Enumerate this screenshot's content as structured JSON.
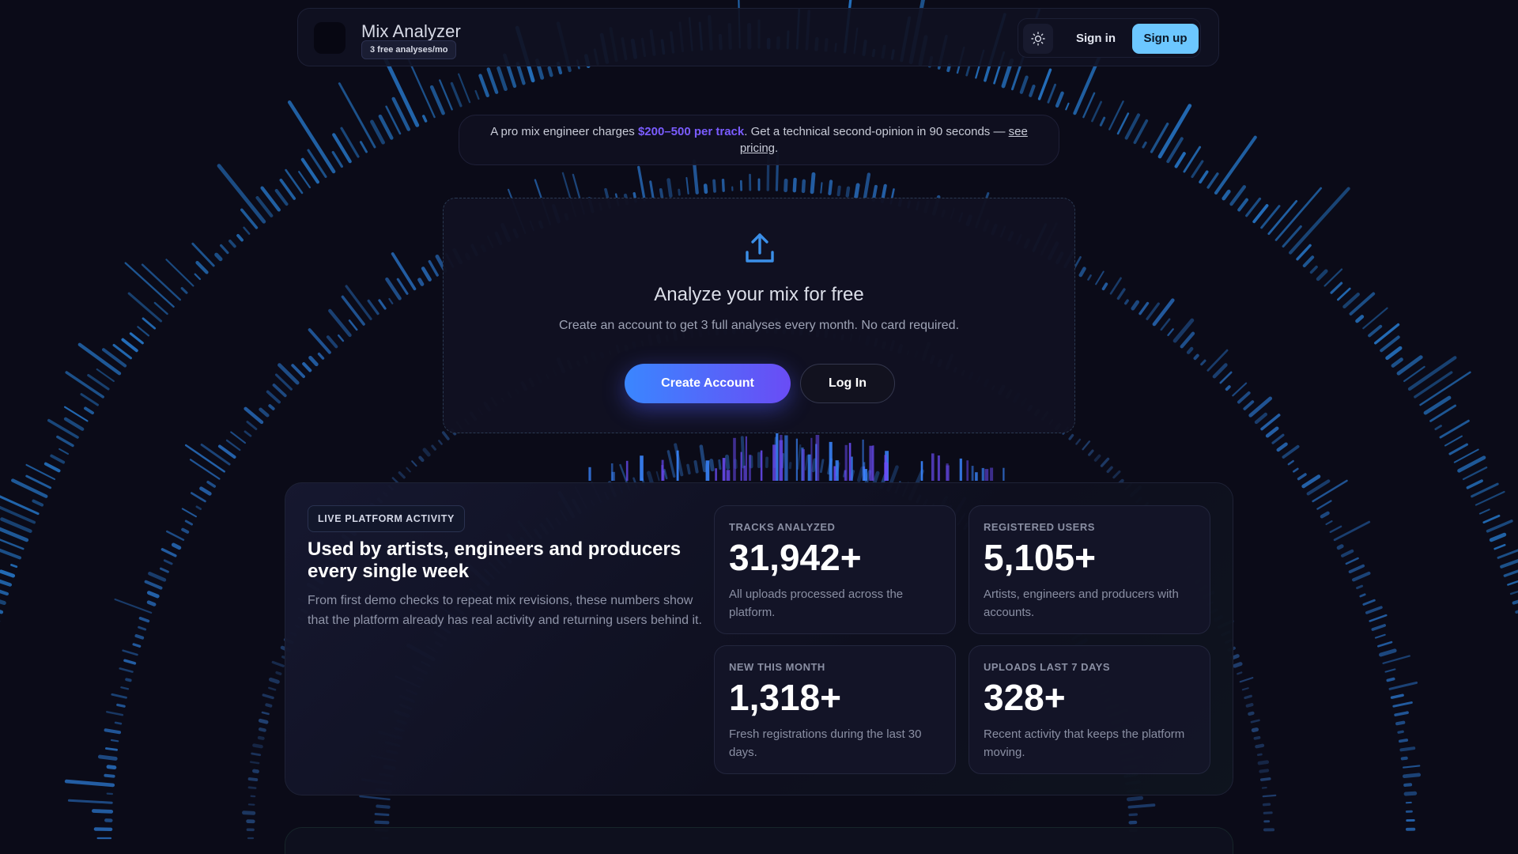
{
  "header": {
    "title": "Mix Analyzer",
    "badge": "3 free analyses/mo",
    "theme_icon": "sun-icon",
    "signin_label": "Sign in",
    "signup_label": "Sign up"
  },
  "banner": {
    "prefix": "A pro mix engineer charges ",
    "price": "$200–500 per track",
    "middle": ". Get a technical second-opinion in 90 seconds — ",
    "link": "see pricing",
    "suffix": "."
  },
  "cta": {
    "icon": "upload-icon",
    "title": "Analyze your mix for free",
    "subtitle": "Create an account to get 3 full analyses every month. No card required.",
    "create_label": "Create Account",
    "login_label": "Log In"
  },
  "stats": {
    "badge": "LIVE PLATFORM ACTIVITY",
    "heading": "Used by artists, engineers and producers every single week",
    "description": "From first demo checks to repeat mix revisions, these numbers show that the platform already has real activity and returning users behind it.",
    "cards": [
      {
        "label": "TRACKS ANALYZED",
        "value": "31,942+",
        "note": "All uploads processed across the platform."
      },
      {
        "label": "REGISTERED USERS",
        "value": "5,105+",
        "note": "Artists, engineers and producers with accounts."
      },
      {
        "label": "NEW THIS MONTH",
        "value": "1,318+",
        "note": "Fresh registrations during the last 30 days."
      },
      {
        "label": "UPLOADS LAST 7 DAYS",
        "value": "328+",
        "note": "Recent activity that keeps the platform moving."
      }
    ]
  },
  "colors": {
    "background": "#0b0b18",
    "accent_blue": "#6cc7ff",
    "accent_purple": "#7a5cff",
    "gradient_start": "#3a86ff",
    "gradient_end": "#6a4cf5"
  }
}
